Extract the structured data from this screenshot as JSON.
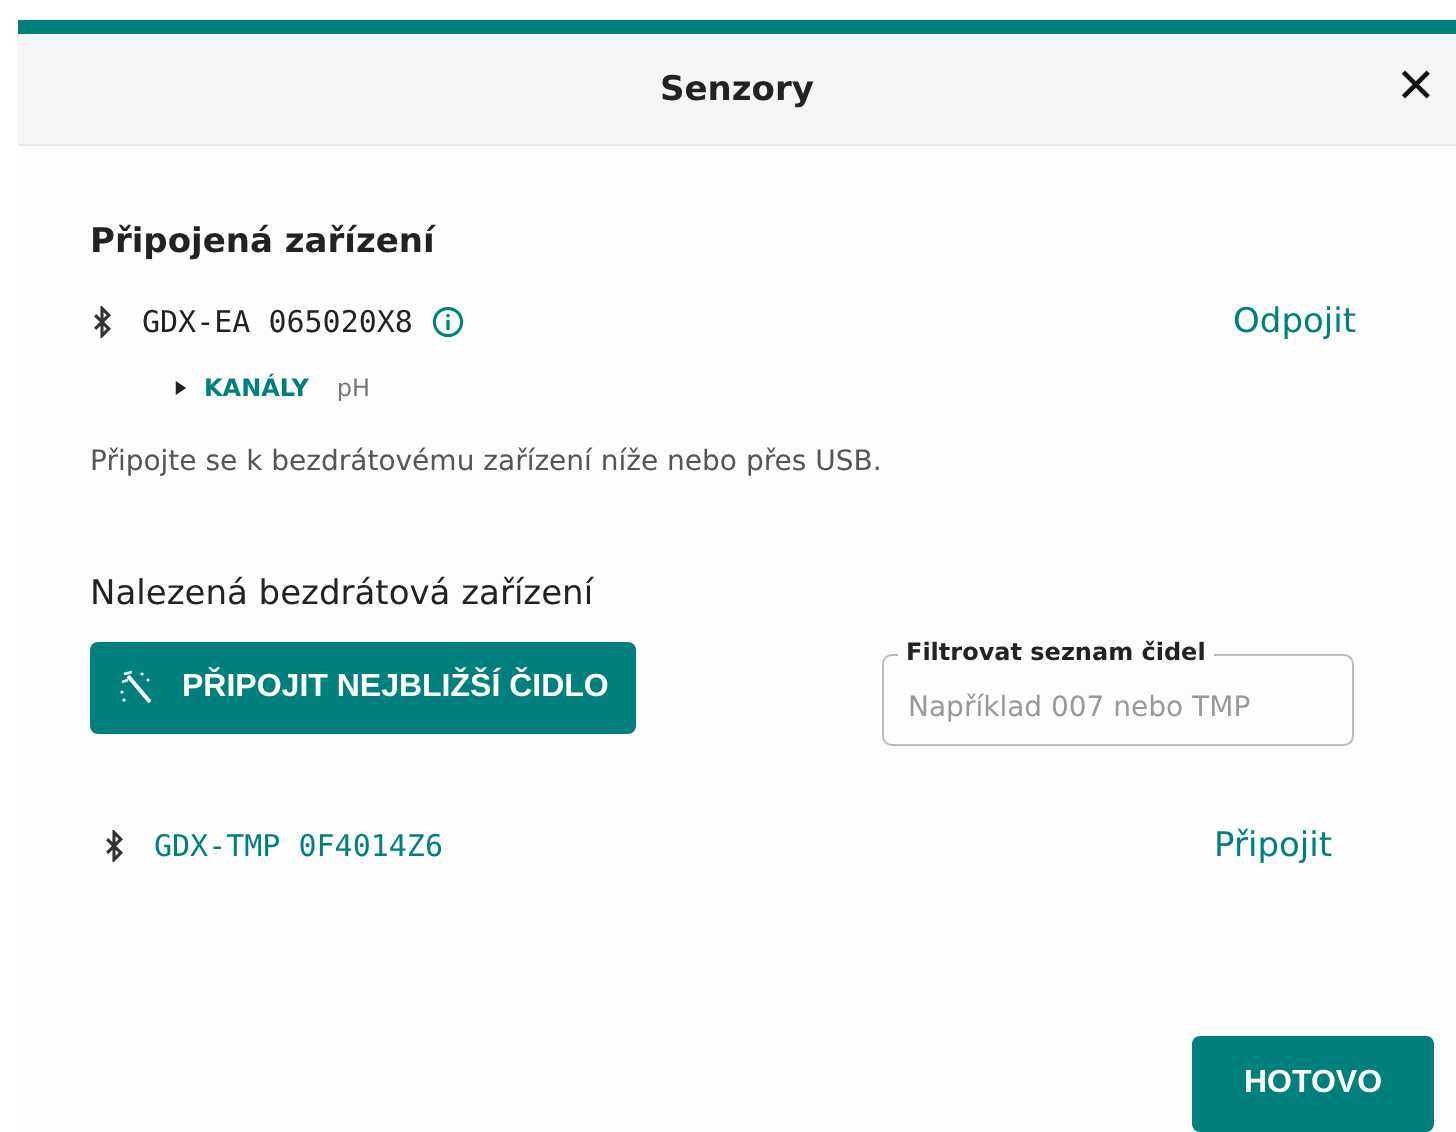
{
  "window": {
    "title": "Senzory",
    "close": "✕"
  },
  "connected": {
    "heading": "Připojená zařízení",
    "devices": [
      {
        "name": "GDX-EA 065020X8",
        "action": "Odpojit",
        "expanded": false,
        "channels_label": "KANÁLY",
        "channels": "pH"
      }
    ]
  },
  "hint": "Připojte se k bezdrátovému zařízení níže nebo přes USB.",
  "found": {
    "heading": "Nalezená bezdrátová zařízení",
    "connect_nearest": "PŘIPOJIT NEJBLIŽŠÍ ČIDLO",
    "filter": {
      "label": "Filtrovat seznam čidel",
      "placeholder": "Například 007 nebo TMP"
    },
    "devices": [
      {
        "name": "GDX-TMP 0F4014Z6",
        "action": "Připojit"
      }
    ]
  },
  "done": "HOTOVO"
}
